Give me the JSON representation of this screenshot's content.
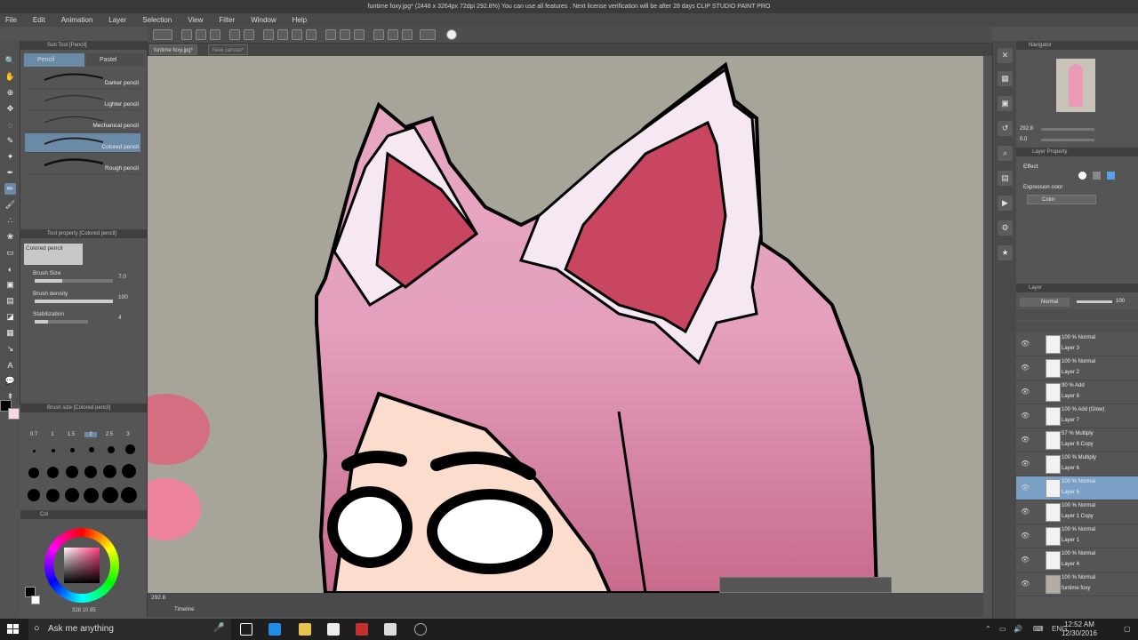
{
  "window": {
    "title": "funtime foxy.jpg* (2448 x 3264px 72dpi 292.8%)  You can use all features . Next license verification will be after 28 days   CLIP STUDIO PAINT PRO"
  },
  "menu": [
    "File",
    "Edit",
    "Animation",
    "Layer",
    "Selection",
    "View",
    "Filter",
    "Window",
    "Help"
  ],
  "tabs": [
    "funtime foxy.jpg*",
    "New canvas*"
  ],
  "subtool": {
    "title": "Sub Tool [Pencil]",
    "tabs": [
      "Pencil",
      "Pastel"
    ],
    "brushes": [
      "Darker pencil",
      "Lighter pencil",
      "Mechanical pencil",
      "Colored pencil",
      "Rough pencil"
    ],
    "selected_index": 3
  },
  "tool_property": {
    "title": "Tool property [Colored pencil]",
    "tool_name": "Colored pencil",
    "brush_size_label": "Brush Size",
    "brush_size_value": "7.0",
    "brush_size_level": 0.35,
    "brush_density_label": "Brush density",
    "brush_density_value": "100",
    "brush_density_level": 1.0,
    "stabilization_label": "Stabilization",
    "stabilization_value": "4",
    "stabilization_level": 0.25
  },
  "brush_size": {
    "title": "Brush size [Colored pencil]",
    "labels": [
      "0.7",
      "1",
      "1.5",
      "2",
      "2.5",
      "3"
    ],
    "selected_index": 3
  },
  "color": {
    "title": "Col",
    "main": "#000000",
    "sub": "#ffffff",
    "readout": "328  10  85"
  },
  "canvas": {
    "zoom": "292.8",
    "background": "#a7a49a",
    "timeline_label": "Timeline"
  },
  "navigator": {
    "title": "Navigator",
    "zoom": "292.8",
    "angle": "0.0"
  },
  "layer_property": {
    "title": "Layer Property",
    "effect_label": "Effect",
    "expression_color_label": "Expression color",
    "expression_color_value": "Color"
  },
  "layers": {
    "title": "Layer",
    "blend_mode": "Normal",
    "opacity": "100",
    "items": [
      {
        "mode": "100 % Normal",
        "name": "Layer 3"
      },
      {
        "mode": "100 % Normal",
        "name": "Layer 2"
      },
      {
        "mode": "90 % Add",
        "name": "Layer 8"
      },
      {
        "mode": "100 % Add (Glow)",
        "name": "Layer 7"
      },
      {
        "mode": "57 % Multiply",
        "name": "Layer 6 Copy"
      },
      {
        "mode": "100 % Multiply",
        "name": "Layer 6"
      },
      {
        "mode": "100 % Normal",
        "name": "Layer 5"
      },
      {
        "mode": "100 % Normal",
        "name": "Layer 1 Copy"
      },
      {
        "mode": "100 % Normal",
        "name": "Layer 1"
      },
      {
        "mode": "100 % Normal",
        "name": "Layer 4"
      },
      {
        "mode": "100 % Normal",
        "name": "funtime foxy"
      }
    ],
    "selected_index": 6
  },
  "taskbar": {
    "search_placeholder": "Ask me anything",
    "language": "ENG",
    "time": "12:52 AM",
    "date": "12/30/2016"
  }
}
